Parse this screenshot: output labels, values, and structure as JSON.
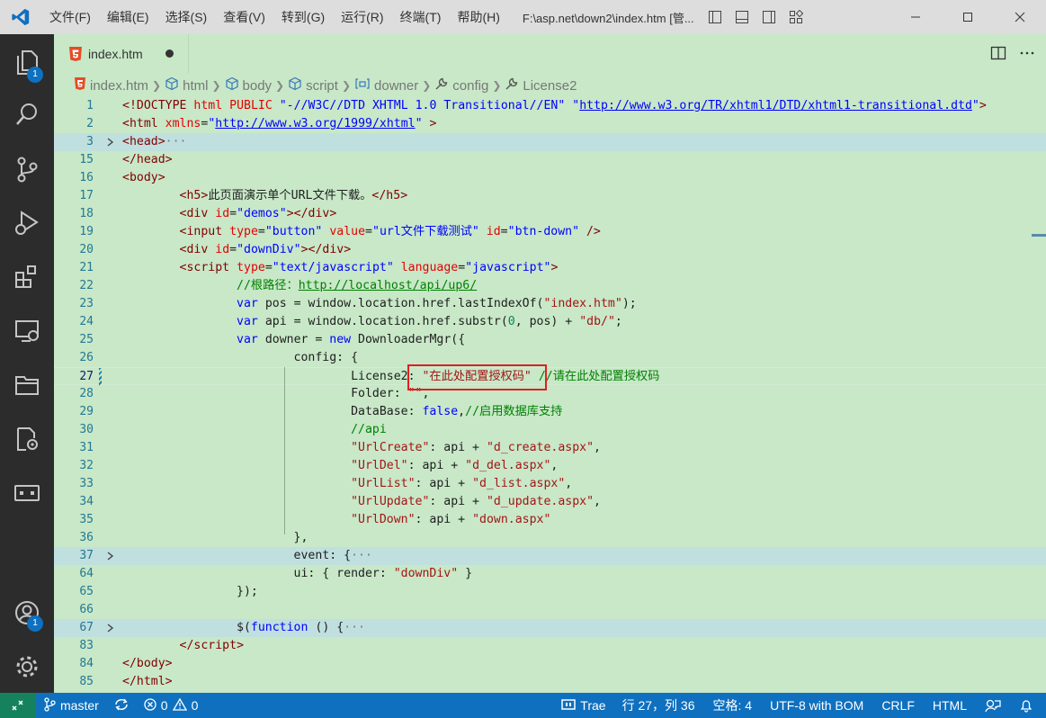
{
  "titlebar": {
    "menu": [
      "文件(F)",
      "编辑(E)",
      "选择(S)",
      "查看(V)",
      "转到(G)",
      "运行(R)",
      "终端(T)",
      "帮助(H)"
    ],
    "title": "F:\\asp.net\\down2\\index.htm [管..."
  },
  "activitybar": {
    "explorer_badge": "1",
    "accounts_badge": "1"
  },
  "tab": {
    "label": "index.htm"
  },
  "breadcrumb": [
    "index.htm",
    "html",
    "body",
    "script",
    "downer",
    "config",
    "License2"
  ],
  "code_lines": [
    {
      "n": "1",
      "html": "<span class='c-punct'>&lt;!</span><span class='c-tag'>DOCTYPE</span> <span class='c-attr'>html</span> <span class='c-attr'>PUBLIC</span> <span class='c-val'>\"-//W3C//DTD XHTML 1.0 Transitional//EN\"</span> <span class='c-val'>\"<span class='c-link'>http://www.w3.org/TR/xhtml1/DTD/xhtml1-transitional.dtd</span>\"</span><span class='c-punct'>&gt;</span>"
    },
    {
      "n": "2",
      "html": "<span class='c-punct'>&lt;</span><span class='c-tag'>html</span> <span class='c-attr'>xmlns</span>=<span class='c-val'>\"<span class='c-link'>http://www.w3.org/1999/xhtml</span>\"</span> <span class='c-punct'>&gt;</span>"
    },
    {
      "n": "3",
      "html": "<span class='c-punct'>&lt;</span><span class='c-tag'>head</span><span class='c-punct'>&gt;</span><span style='color:#777'>···</span>",
      "fold": true,
      "hl": true
    },
    {
      "n": "15",
      "html": "<span class='c-punct'>&lt;/</span><span class='c-tag'>head</span><span class='c-punct'>&gt;</span>"
    },
    {
      "n": "16",
      "html": "<span class='c-punct'>&lt;</span><span class='c-tag'>body</span><span class='c-punct'>&gt;</span>"
    },
    {
      "n": "17",
      "html": "        <span class='c-punct'>&lt;</span><span class='c-tag'>h5</span><span class='c-punct'>&gt;</span>此页面演示单个URL文件下载。<span class='c-punct'>&lt;/</span><span class='c-tag'>h5</span><span class='c-punct'>&gt;</span>"
    },
    {
      "n": "18",
      "html": "        <span class='c-punct'>&lt;</span><span class='c-tag'>div</span> <span class='c-attr'>id</span>=<span class='c-val'>\"demos\"</span><span class='c-punct'>&gt;&lt;/</span><span class='c-tag'>div</span><span class='c-punct'>&gt;</span>"
    },
    {
      "n": "19",
      "html": "        <span class='c-punct'>&lt;</span><span class='c-tag'>input</span> <span class='c-attr'>type</span>=<span class='c-val'>\"button\"</span> <span class='c-attr'>value</span>=<span class='c-val'>\"url文件下载测试\"</span> <span class='c-attr'>id</span>=<span class='c-val'>\"btn-down\"</span> <span class='c-punct'>/&gt;</span>"
    },
    {
      "n": "20",
      "html": "        <span class='c-punct'>&lt;</span><span class='c-tag'>div</span> <span class='c-attr'>id</span>=<span class='c-val'>\"downDiv\"</span><span class='c-punct'>&gt;&lt;/</span><span class='c-tag'>div</span><span class='c-punct'>&gt;</span>"
    },
    {
      "n": "21",
      "html": "        <span class='c-punct'>&lt;</span><span class='c-tag'>script</span> <span class='c-attr'>type</span>=<span class='c-val'>\"text/javascript\"</span> <span class='c-attr'>language</span>=<span class='c-val'>\"javascript\"</span><span class='c-punct'>&gt;</span>"
    },
    {
      "n": "22",
      "html": "                <span class='c-com'>//根路径：<span style='text-decoration:underline'>http://localhost/api/up6/</span></span>"
    },
    {
      "n": "23",
      "html": "                <span class='c-kw'>var</span> pos = window.location.href.lastIndexOf(<span class='c-str-js'>\"index.htm\"</span>);"
    },
    {
      "n": "24",
      "html": "                <span class='c-kw'>var</span> api = window.location.href.substr(<span style='color:#098658'>0</span>, pos) + <span class='c-str-js'>\"db/\"</span>;"
    },
    {
      "n": "25",
      "html": "                <span class='c-kw'>var</span> downer = <span class='c-kw'>new</span> DownloaderMgr({"
    },
    {
      "n": "26",
      "html": "                        config: {"
    },
    {
      "n": "27",
      "html": "                                License2: <span class='c-str-js'>\"在此处配置授权码\"</span> <span class='c-com'>//请在此处配置授权码</span>",
      "cur": true,
      "mod": true
    },
    {
      "n": "28",
      "html": "                                Folder: <span class='c-str-js'>\"\"</span>,"
    },
    {
      "n": "29",
      "html": "                                DataBase: <span class='c-kw'>false</span>,<span class='c-com'>//启用数据库支持</span>"
    },
    {
      "n": "30",
      "html": "                                <span class='c-com'>//api</span>"
    },
    {
      "n": "31",
      "html": "                                <span class='c-str-js'>\"UrlCreate\"</span>: api + <span class='c-str-js'>\"d_create.aspx\"</span>,"
    },
    {
      "n": "32",
      "html": "                                <span class='c-str-js'>\"UrlDel\"</span>: api + <span class='c-str-js'>\"d_del.aspx\"</span>,"
    },
    {
      "n": "33",
      "html": "                                <span class='c-str-js'>\"UrlList\"</span>: api + <span class='c-str-js'>\"d_list.aspx\"</span>,"
    },
    {
      "n": "34",
      "html": "                                <span class='c-str-js'>\"UrlUpdate\"</span>: api + <span class='c-str-js'>\"d_update.aspx\"</span>,"
    },
    {
      "n": "35",
      "html": "                                <span class='c-str-js'>\"UrlDown\"</span>: api + <span class='c-str-js'>\"down.aspx\"</span>"
    },
    {
      "n": "36",
      "html": "                        },"
    },
    {
      "n": "37",
      "html": "                        event: {<span style='color:#777'>···</span>",
      "fold": true,
      "hl": true
    },
    {
      "n": "64",
      "html": "                        ui: { render: <span class='c-str-js'>\"downDiv\"</span> }"
    },
    {
      "n": "65",
      "html": "                });"
    },
    {
      "n": "66",
      "html": ""
    },
    {
      "n": "67",
      "html": "                $(<span class='c-kw'>function</span> () {<span style='color:#777'>···</span>",
      "fold": true,
      "hl": true
    },
    {
      "n": "83",
      "html": "        <span class='c-punct'>&lt;/</span><span class='c-tag'>script</span><span class='c-punct'>&gt;</span>"
    },
    {
      "n": "84",
      "html": "<span class='c-punct'>&lt;/</span><span class='c-tag'>body</span><span class='c-punct'>&gt;</span>"
    },
    {
      "n": "85",
      "html": "<span class='c-punct'>&lt;/</span><span class='c-tag'>html</span><span class='c-punct'>&gt;</span>"
    }
  ],
  "statusbar": {
    "branch": "master",
    "errors": "0",
    "warnings": "0",
    "extension": "Trae",
    "position": "行 27，列 36",
    "spaces": "空格: 4",
    "encoding": "UTF-8 with BOM",
    "eol": "CRLF",
    "language": "HTML"
  },
  "colors": {
    "editor_bg": "#c8e8c8",
    "activitybar_bg": "#2c2c2c",
    "statusbar_bg": "#0f70bf",
    "highlight_box": "#e02020"
  }
}
